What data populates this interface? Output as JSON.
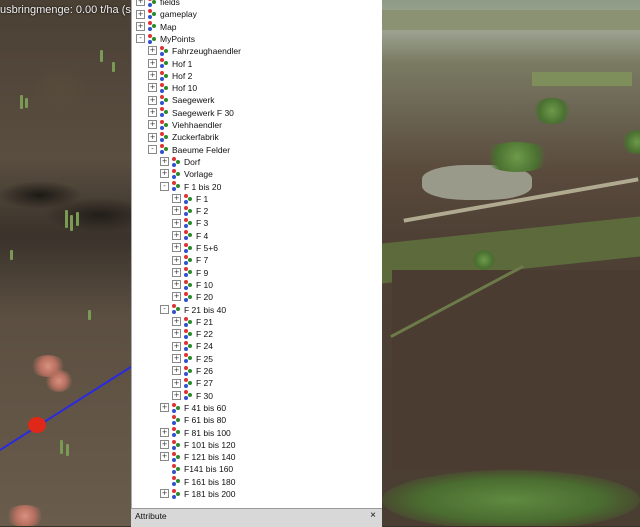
{
  "overlay": {
    "text": "usbringmenge: 0.00 t/ha (s"
  },
  "tree": {
    "items": [
      {
        "label": "fields",
        "level": 0,
        "expander": "+"
      },
      {
        "label": "gameplay",
        "level": 0,
        "expander": "+"
      },
      {
        "label": "Map",
        "level": 0,
        "expander": "+"
      },
      {
        "label": "MyPoints",
        "level": 0,
        "expander": "-"
      },
      {
        "label": "Fahrzeughaendler",
        "level": 1,
        "expander": "+"
      },
      {
        "label": "Hof 1",
        "level": 1,
        "expander": "+"
      },
      {
        "label": "Hof 2",
        "level": 1,
        "expander": "+"
      },
      {
        "label": "Hof 10",
        "level": 1,
        "expander": "+"
      },
      {
        "label": "Saegewerk",
        "level": 1,
        "expander": "+"
      },
      {
        "label": "Saegewerk F 30",
        "level": 1,
        "expander": "+"
      },
      {
        "label": "Viehhaendler",
        "level": 1,
        "expander": "+"
      },
      {
        "label": "Zuckerfabrik",
        "level": 1,
        "expander": "+"
      },
      {
        "label": "Baeume Felder",
        "level": 1,
        "expander": "-"
      },
      {
        "label": "Dorf",
        "level": 2,
        "expander": "+"
      },
      {
        "label": "Vorlage",
        "level": 2,
        "expander": "+"
      },
      {
        "label": "F 1 bis 20",
        "level": 2,
        "expander": "-"
      },
      {
        "label": "F 1",
        "level": 3,
        "expander": "+"
      },
      {
        "label": "F 2",
        "level": 3,
        "expander": "+"
      },
      {
        "label": "F 3",
        "level": 3,
        "expander": "+"
      },
      {
        "label": "F 4",
        "level": 3,
        "expander": "+"
      },
      {
        "label": "F 5+6",
        "level": 3,
        "expander": "+"
      },
      {
        "label": "F 7",
        "level": 3,
        "expander": "+"
      },
      {
        "label": "F 9",
        "level": 3,
        "expander": "+"
      },
      {
        "label": "F 10",
        "level": 3,
        "expander": "+"
      },
      {
        "label": "F 20",
        "level": 3,
        "expander": "+"
      },
      {
        "label": "F 21 bis 40",
        "level": 2,
        "expander": "-"
      },
      {
        "label": "F 21",
        "level": 3,
        "expander": "+"
      },
      {
        "label": "F 22",
        "level": 3,
        "expander": "+"
      },
      {
        "label": "F 24",
        "level": 3,
        "expander": "+"
      },
      {
        "label": "F 25",
        "level": 3,
        "expander": "+"
      },
      {
        "label": "F 26",
        "level": 3,
        "expander": "+"
      },
      {
        "label": "F 27",
        "level": 3,
        "expander": "+"
      },
      {
        "label": "F 30",
        "level": 3,
        "expander": "+"
      },
      {
        "label": "F 41 bis 60",
        "level": 2,
        "expander": "+"
      },
      {
        "label": "F 61 bis 80",
        "level": 2,
        "expander": ""
      },
      {
        "label": "F 81 bis 100",
        "level": 2,
        "expander": "+"
      },
      {
        "label": "F 101 bis 120",
        "level": 2,
        "expander": "+"
      },
      {
        "label": "F 121 bis 140",
        "level": 2,
        "expander": "+"
      },
      {
        "label": "F141 bis 160",
        "level": 2,
        "expander": ""
      },
      {
        "label": "F 161 bis 180",
        "level": 2,
        "expander": ""
      },
      {
        "label": "F 181 bis 200",
        "level": 2,
        "expander": "+"
      }
    ]
  },
  "attribute_bar": {
    "label": "Attribute",
    "close": "×"
  }
}
